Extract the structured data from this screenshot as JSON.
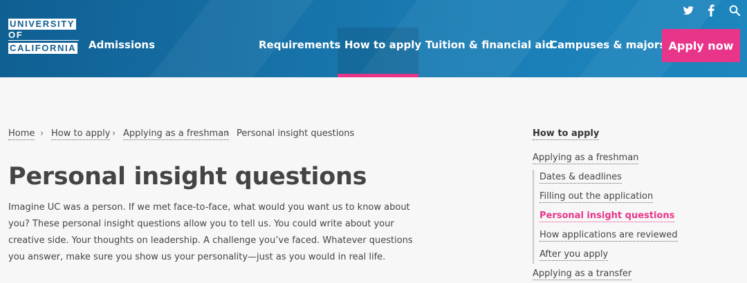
{
  "header": {
    "logo_lines": [
      "UNIVERSITY",
      "OF",
      "CALIFORNIA"
    ],
    "brand": "Admissions",
    "nav": [
      "Requirements",
      "How to apply",
      "Tuition & financial aid",
      "Campuses & majors"
    ],
    "active_nav": "How to apply",
    "cta": "Apply now",
    "social_icons": [
      "twitter-icon",
      "facebook-icon",
      "search-icon"
    ]
  },
  "breadcrumb": [
    "Home",
    "How to apply",
    "Applying as a freshman",
    "Personal insight questions"
  ],
  "main": {
    "title": "Personal insight questions",
    "intro": "Imagine UC was a person. If we met face-to-face, what would you want us to know about you? These personal insight questions allow you to tell us. You could write about your creative side. Your thoughts on leadership. A challenge you’ve faced. Whatever questions you answer, make sure you show us your personality—just as you would in real life."
  },
  "sidebar": {
    "heading": "How to apply",
    "section": "Applying as a freshman",
    "items": [
      "Dates & deadlines",
      "Filling out the application",
      "Personal insight questions",
      "How applications are reviewed",
      "After you apply"
    ],
    "next_section": "Applying as a transfer"
  },
  "colors": {
    "header_blue": "#1670a6",
    "accent_pink": "#e8358a",
    "background": "#f7f7f7"
  }
}
